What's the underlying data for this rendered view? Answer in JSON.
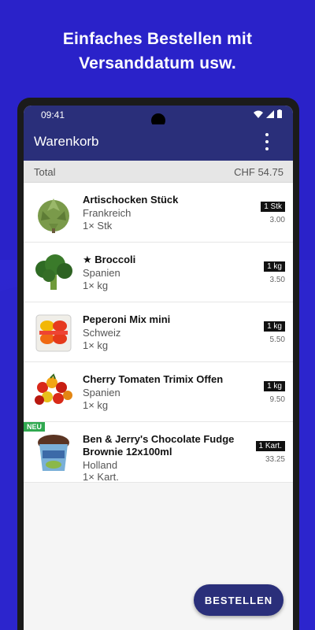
{
  "headline": {
    "line1": "Einfaches Bestellen mit",
    "line2": "Versanddatum usw."
  },
  "status_bar": {
    "time": "09:41"
  },
  "app_bar": {
    "title": "Warenkorb"
  },
  "total": {
    "label": "Total",
    "value": "CHF 54.75"
  },
  "items": [
    {
      "name": "Artischocken Stück",
      "origin": "Frankreich",
      "qty": "1× Stk",
      "unit": "1 Stk",
      "price": "3.00",
      "image": "artichoke"
    },
    {
      "name": "★ Broccoli",
      "origin": "Spanien",
      "qty": "1× kg",
      "unit": "1 kg",
      "price": "3.50",
      "image": "broccoli"
    },
    {
      "name": "Peperoni Mix mini",
      "origin": "Schweiz",
      "qty": "1× kg",
      "unit": "1 kg",
      "price": "5.50",
      "image": "peppers"
    },
    {
      "name": "Cherry Tomaten Trimix Offen",
      "origin": "Spanien",
      "qty": "1× kg",
      "unit": "1 kg",
      "price": "9.50",
      "image": "tomatoes"
    },
    {
      "name": "Ben & Jerry's Chocolate Fudge Brownie 12x100ml",
      "origin": "Holland",
      "qty": "1× Kart.",
      "unit": "1 Kart.",
      "price": "33.25",
      "image": "icecream",
      "badge": "NEU"
    }
  ],
  "order_button": {
    "label": "BESTELLEN"
  },
  "colors": {
    "background": "#2a22c9",
    "primary": "#2a2f7a",
    "badge_new": "#2fa84f"
  }
}
